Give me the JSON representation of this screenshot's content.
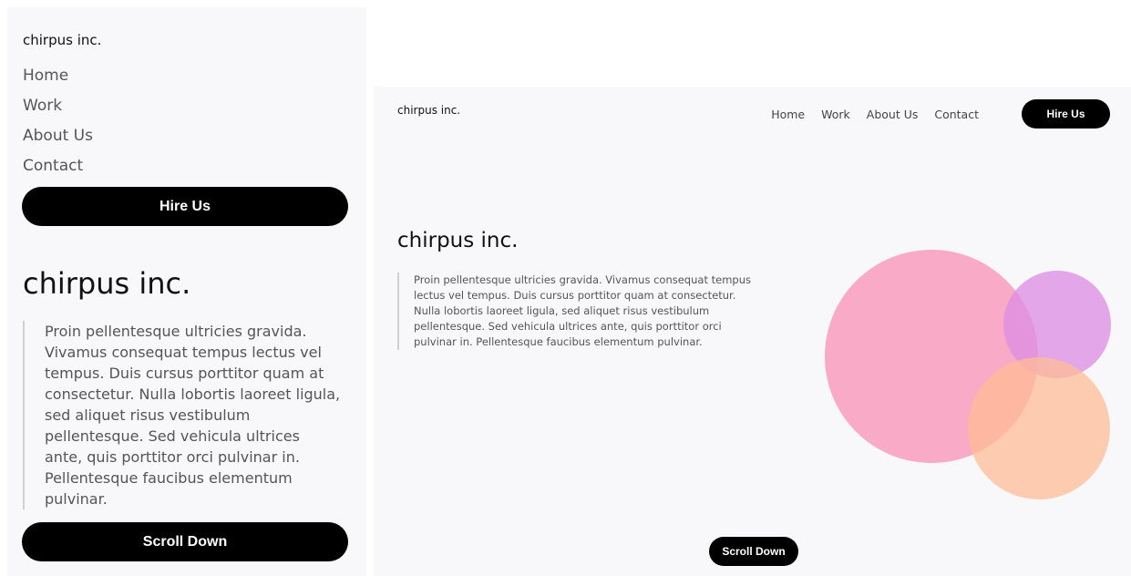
{
  "brand": "chirpus inc.",
  "nav": {
    "items": [
      {
        "label": "Home"
      },
      {
        "label": "Work"
      },
      {
        "label": "About Us"
      },
      {
        "label": "Contact"
      }
    ],
    "hire_label": "Hire Us"
  },
  "hero": {
    "title": "chirpus inc.",
    "quote": "Proin pellentesque ultricies gravida. Vivamus consequat tempus lectus vel tempus. Duis cursus porttitor quam at consectetur. Nulla lobortis laoreet ligula, sed aliquet risus vestibulum pellentesque. Sed vehicula ultrices ante, quis porttitor orci pulvinar in. Pellentesque faucibus elementum pulvinar.",
    "scroll_label": "Scroll Down"
  },
  "colors": {
    "circle_pink": "#f990b5",
    "circle_purple": "#dc8ce3",
    "circle_peach": "#ffbc95",
    "button": "#000000",
    "panel_bg": "#f8f8fb"
  }
}
